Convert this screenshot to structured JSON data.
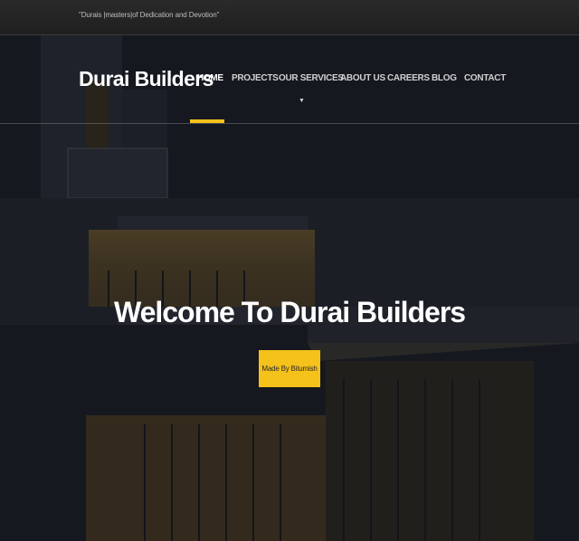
{
  "topbar": {
    "tagline": "\"Durais |masters|of Dedication and Devotion\""
  },
  "header": {
    "brand": "Durai Builders",
    "nav": [
      {
        "label": "HOME"
      },
      {
        "label": "PROJECTS"
      },
      {
        "label": "OUR SERVICES"
      },
      {
        "label": "ABOUT US"
      },
      {
        "label": "CAREERS"
      },
      {
        "label": "BLOG"
      },
      {
        "label": "CONTACT"
      }
    ],
    "dropdown_caret": "▼",
    "accent_color": "#f5c11b"
  },
  "hero": {
    "heading": "Welcome To Durai Builders",
    "button_label": "Made By Bitumish"
  }
}
